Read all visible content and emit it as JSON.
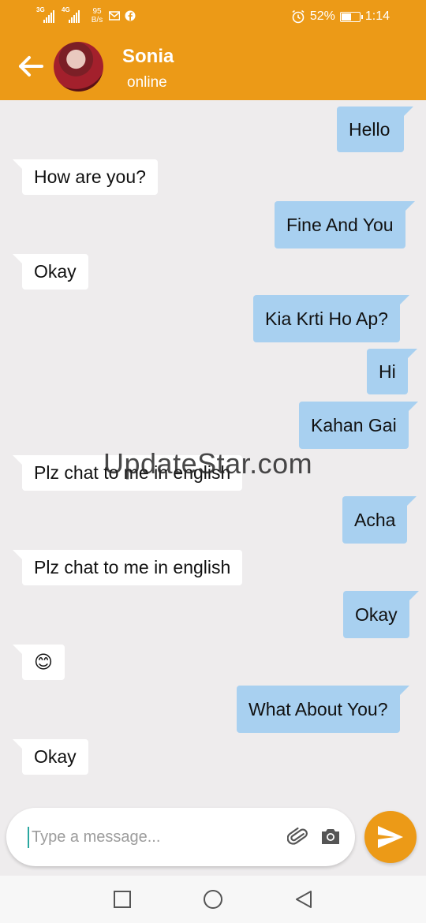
{
  "status_bar": {
    "net1_tag": "3G",
    "net2_tag": "4G",
    "speed_value": "95",
    "speed_unit": "B/s",
    "battery": "52%",
    "battery_level": 0.52,
    "time": "1:14",
    "icons": [
      "signal-icon",
      "signal-icon",
      "gmail-icon",
      "facebook-icon",
      "alarm-icon",
      "battery-icon"
    ]
  },
  "header": {
    "name": "Sonia",
    "status": "online",
    "icons": [
      "back-arrow-icon",
      "avatar"
    ]
  },
  "messages": [
    {
      "dir": "out",
      "text": "Hello"
    },
    {
      "dir": "in",
      "text": "How are you?"
    },
    {
      "dir": "out",
      "text": "Fine And You"
    },
    {
      "dir": "in",
      "text": "Okay"
    },
    {
      "dir": "out",
      "text": "Kia Krti Ho Ap?"
    },
    {
      "dir": "out",
      "text": "Hi"
    },
    {
      "dir": "out",
      "text": "Kahan Gai"
    },
    {
      "dir": "in",
      "text": "Plz chat to me in english"
    },
    {
      "dir": "out",
      "text": "Acha"
    },
    {
      "dir": "in",
      "text": "Plz chat to me in english"
    },
    {
      "dir": "out",
      "text": "Okay"
    },
    {
      "dir": "in",
      "text": "😊"
    },
    {
      "dir": "out",
      "text": "What About You?"
    },
    {
      "dir": "in",
      "text": "Okay"
    }
  ],
  "watermark": "UpdateStar.com",
  "composer": {
    "placeholder": "Type a message...",
    "value": "",
    "icons": [
      "attach-icon",
      "camera-icon",
      "send-icon"
    ]
  },
  "nav": {
    "icons": [
      "recent-apps-icon",
      "home-icon",
      "back-icon"
    ]
  },
  "colors": {
    "accent": "#ec9a17",
    "outgoing_bubble": "#a8d0f0",
    "incoming_bubble": "#ffffff",
    "background": "#eeeced"
  }
}
